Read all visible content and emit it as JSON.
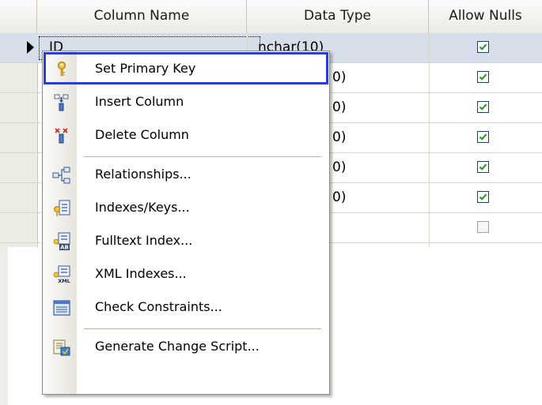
{
  "grid": {
    "columns": [
      "Column Name",
      "Data Type",
      "Allow Nulls"
    ],
    "rows": [
      {
        "name": "ID",
        "type": "nchar(10)",
        "allow_nulls": true
      },
      {
        "name": "",
        "type": "0)",
        "allow_nulls": true
      },
      {
        "name": "",
        "type": "0)",
        "allow_nulls": true
      },
      {
        "name": "",
        "type": "0)",
        "allow_nulls": true
      },
      {
        "name": "",
        "type": "0)",
        "allow_nulls": true
      },
      {
        "name": "",
        "type": "0)",
        "allow_nulls": true
      },
      {
        "name": "",
        "type": "",
        "allow_nulls": false
      }
    ]
  },
  "context_menu": {
    "items": [
      {
        "label": "Set Primary Key",
        "icon": "key-icon"
      },
      {
        "label": "Insert Column",
        "icon": "insert-column-icon"
      },
      {
        "label": "Delete Column",
        "icon": "delete-column-icon"
      },
      {
        "label": "Relationships...",
        "icon": "relationships-icon"
      },
      {
        "label": "Indexes/Keys...",
        "icon": "indexes-keys-icon"
      },
      {
        "label": "Fulltext Index...",
        "icon": "fulltext-index-icon"
      },
      {
        "label": "XML Indexes...",
        "icon": "xml-indexes-icon"
      },
      {
        "label": "Check Constraints...",
        "icon": "check-constraints-icon"
      },
      {
        "label": "Generate Change Script...",
        "icon": "change-script-icon"
      }
    ],
    "highlighted_item": "Set Primary Key"
  },
  "colors": {
    "selected_row": "#d6dfe9",
    "highlight_border": "#2a3fd0",
    "checkbox_check": "#2a9a2a"
  }
}
